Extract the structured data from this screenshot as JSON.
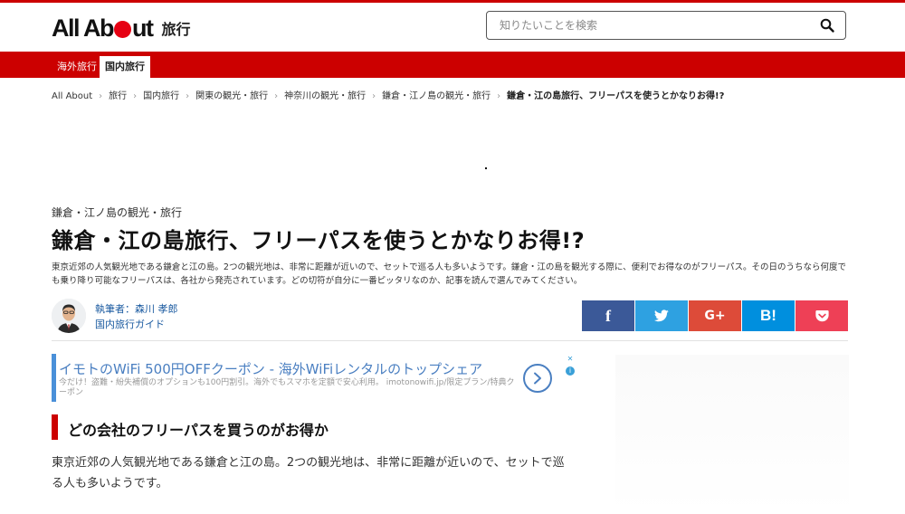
{
  "brand": {
    "logo": "All About",
    "section": "旅行"
  },
  "search": {
    "placeholder": "知りたいことを検索",
    "icon": "search-icon"
  },
  "nav": {
    "tabs": [
      {
        "label": "海外旅行",
        "active": false
      },
      {
        "label": "国内旅行",
        "active": true
      }
    ]
  },
  "breadcrumb": [
    "All About",
    "旅行",
    "国内旅行",
    "関東の観光・旅行",
    "神奈川の観光・旅行",
    "鎌倉・江ノ島の観光・旅行",
    "鎌倉・江の島旅行、フリーパスを使うとかなりお得!?"
  ],
  "article": {
    "category": "鎌倉・江ノ島の観光・旅行",
    "title": "鎌倉・江の島旅行、フリーパスを使うとかなりお得!?",
    "lead": "東京近郊の人気観光地である鎌倉と江の島。2つの観光地は、非常に距離が近いので、セットで巡る人も多いようです。鎌倉・江の島を観光する際に、便利でお得なのがフリーパス。その日のうちなら何度でも乗り降り可能なフリーパスは、各社から発売されています。どの切符が自分に一番ピッタリなのか、記事を読んで選んでみてください。",
    "author": {
      "name": "執筆者：森川 孝郎",
      "role": "国内旅行ガイド"
    },
    "share": [
      {
        "label": "f",
        "icon": "facebook-icon",
        "color": "#3b5998"
      },
      {
        "label": "",
        "icon": "twitter-icon",
        "color": "#2ea1e1"
      },
      {
        "label": "G+",
        "icon": "google-plus-icon",
        "color": "#dd4b39"
      },
      {
        "label": "B!",
        "icon": "hatena-bookmark-icon",
        "color": "#008fde"
      },
      {
        "label": "",
        "icon": "pocket-icon",
        "color": "#ee4056"
      }
    ],
    "heading": "どの会社のフリーパスを買うのがお得か",
    "body": "東京近郊の人気観光地である鎌倉と江の島。2つの観光地は、非常に距離が近いので、セットで巡る人も多いようです。"
  },
  "ad": {
    "title": "イモトのWiFi 500円OFFクーポン - 海外WiFiレンタルのトップシェア",
    "description": "今だけ！盗難・紛失補償のオプションも100円割引。海外でもスマホを定額で安心利用。 imotonowifi.jp/限定プラン/特典クーポン",
    "accent": "#4a7fc1"
  },
  "colors": {
    "brand_red": "#cc0000",
    "link_blue": "#1a5aa0"
  }
}
